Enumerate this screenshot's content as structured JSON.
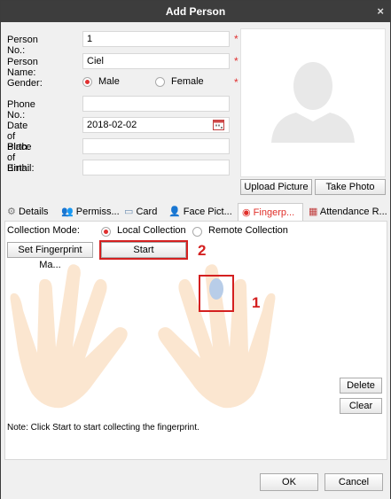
{
  "dialog": {
    "title": "Add Person",
    "close_label": "×"
  },
  "form": {
    "person_no": {
      "label": "Person No.:",
      "value": "1",
      "required": "*"
    },
    "person_name": {
      "label": "Person Name:",
      "value": "Ciel",
      "required": "*"
    },
    "gender": {
      "label": "Gender:",
      "options": [
        "Male",
        "Female"
      ],
      "selected": "Male",
      "required": "*"
    },
    "phone_no": {
      "label": "Phone No.:",
      "value": ""
    },
    "date_of_birth": {
      "label": "Date of Birth:",
      "value": "2018-02-02"
    },
    "place_of_birth": {
      "label": "Place of Birth:",
      "value": ""
    },
    "email": {
      "label": "Email:",
      "value": ""
    }
  },
  "photo": {
    "upload_label": "Upload Picture",
    "take_label": "Take Photo"
  },
  "tabs": [
    {
      "label": "Details",
      "icon": "gear-icon"
    },
    {
      "label": "Permiss...",
      "icon": "people-icon"
    },
    {
      "label": "Card",
      "icon": "card-icon"
    },
    {
      "label": "Face Pict...",
      "icon": "person-icon"
    },
    {
      "label": "Fingerp...",
      "icon": "fingerprint-icon",
      "active": true
    },
    {
      "label": "Attendance R...",
      "icon": "calendar-icon"
    }
  ],
  "fingerprint": {
    "collection_mode_label": "Collection Mode:",
    "modes": [
      "Local Collection",
      "Remote Collection"
    ],
    "selected_mode": "Local Collection",
    "set_button": "Set Fingerprint Ma...",
    "start_button": "Start",
    "delete_button": "Delete",
    "clear_button": "Clear",
    "note": "Note: Click Start to start collecting the fingerprint."
  },
  "annotations": {
    "marker_1": "1",
    "marker_2": "2",
    "color": "#d42020"
  },
  "footer": {
    "ok_label": "OK",
    "cancel_label": "Cancel"
  }
}
